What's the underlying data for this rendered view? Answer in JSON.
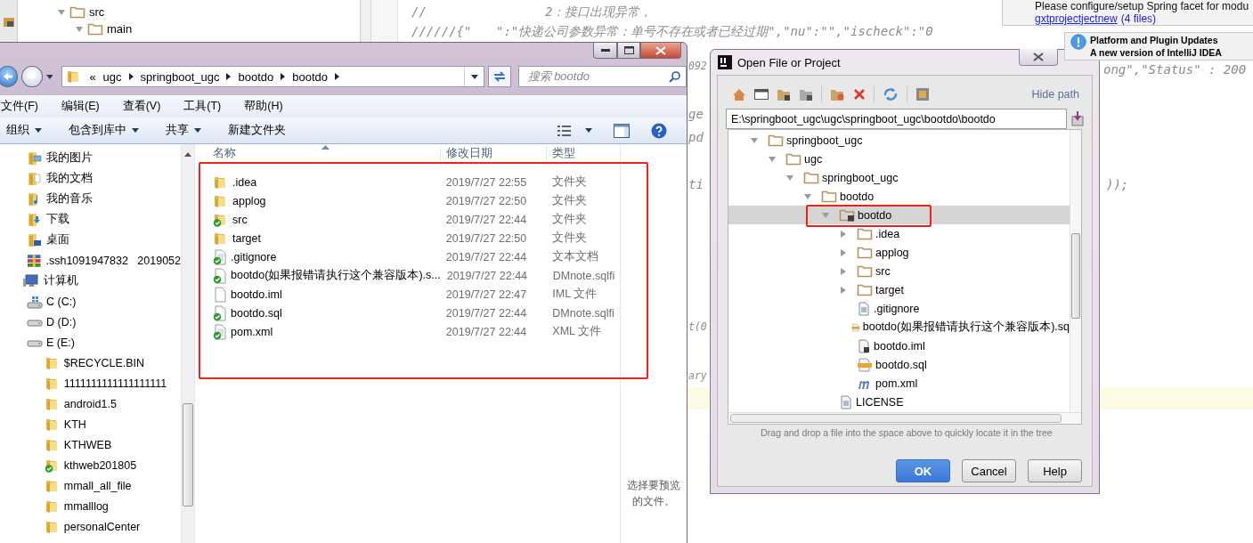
{
  "ide": {
    "project_tree": [
      {
        "label": "src",
        "expanded": true,
        "children": [
          {
            "label": "main",
            "expanded": true
          }
        ]
      }
    ],
    "code_fragments": [
      "//",
      "2：接口出现异常，",
      "//////{\"",
      "\":\"快递公司参数异常：单号不存在或者已经过期\",\"nu\":\"\",\"ischeck\":\"0",
      "092",
      "ong\",\"Status\" : 200",
      "ge",
      "pd",
      "ti",
      "));",
      "t(0",
      "ary"
    ],
    "notifications": [
      {
        "kind": "warning",
        "text": "Please configure/setup Spring facet for modu",
        "link": "gxtprojectjectnew",
        "files_link": "(4 files)"
      },
      {
        "kind": "info",
        "title": "Platform and Plugin Updates",
        "text": "A new version of IntelliJ IDEA"
      }
    ]
  },
  "explorer": {
    "address": {
      "overflow": "«",
      "crumbs": [
        "ugc",
        "springboot_ugc",
        "bootdo",
        "bootdo"
      ]
    },
    "search": {
      "placeholder": "搜索 bootdo"
    },
    "menu": [
      "文件(F)",
      "编辑(E)",
      "查看(V)",
      "工具(T)",
      "帮助(H)"
    ],
    "toolbar": [
      {
        "label": "组织",
        "dropdown": true
      },
      {
        "label": "包含到库中",
        "dropdown": true
      },
      {
        "label": "共享",
        "dropdown": true
      },
      {
        "label": "新建文件夹",
        "dropdown": false
      }
    ],
    "nav": [
      {
        "label": "我的图片",
        "kind": "pictures"
      },
      {
        "label": "我的文档",
        "kind": "documents"
      },
      {
        "label": "我的音乐",
        "kind": "music"
      },
      {
        "label": "下载",
        "kind": "downloads"
      },
      {
        "label": "桌面",
        "kind": "desktop"
      },
      {
        "label": ".ssh1091947832   2019052",
        "kind": "archive"
      },
      {
        "label": "计算机",
        "kind": "computer",
        "children": [
          {
            "label": "C (C:)",
            "kind": "system-drive"
          },
          {
            "label": "D (D:)",
            "kind": "drive"
          },
          {
            "label": "E (E:)",
            "kind": "drive",
            "children": [
              {
                "label": "$RECYCLE.BIN",
                "kind": "folder"
              },
              {
                "label": "1111111111111111111",
                "kind": "folder"
              },
              {
                "label": "android1.5",
                "kind": "folder"
              },
              {
                "label": "KTH",
                "kind": "folder"
              },
              {
                "label": "KTHWEB",
                "kind": "folder"
              },
              {
                "label": "kthweb201805",
                "kind": "synced-folder"
              },
              {
                "label": "mmall_all_file",
                "kind": "folder"
              },
              {
                "label": "mmalllog",
                "kind": "folder"
              },
              {
                "label": "personalCenter",
                "kind": "folder"
              }
            ]
          }
        ]
      }
    ],
    "columns": [
      "名称",
      "修改日期",
      "类型"
    ],
    "files": [
      {
        "name": ".idea",
        "date": "2019/7/27 22:55",
        "type": "文件夹",
        "kind": "folder",
        "synced": false
      },
      {
        "name": "applog",
        "date": "2019/7/27 22:50",
        "type": "文件夹",
        "kind": "folder",
        "synced": false
      },
      {
        "name": "src",
        "date": "2019/7/27 22:44",
        "type": "文件夹",
        "kind": "folder",
        "synced": true
      },
      {
        "name": "target",
        "date": "2019/7/27 22:50",
        "type": "文件夹",
        "kind": "folder",
        "synced": false
      },
      {
        "name": ".gitignore",
        "date": "2019/7/27 22:44",
        "type": "文本文档",
        "kind": "document",
        "synced": true
      },
      {
        "name": "bootdo(如果报错请执行这个兼容版本).s...",
        "date": "2019/7/27 22:44",
        "type": "DMnote.sqlfi",
        "kind": "blank",
        "synced": true
      },
      {
        "name": "bootdo.iml",
        "date": "2019/7/27 22:47",
        "type": "IML 文件",
        "kind": "blank",
        "synced": false
      },
      {
        "name": "bootdo.sql",
        "date": "2019/7/27 22:44",
        "type": "DMnote.sqlfi",
        "kind": "blank",
        "synced": true
      },
      {
        "name": "pom.xml",
        "date": "2019/7/27 22:44",
        "type": "XML 文件",
        "kind": "document",
        "synced": true
      }
    ],
    "preview": "选择要预览的文件。"
  },
  "dialog": {
    "title": "Open File or Project",
    "hide_path": "Hide path",
    "path": "E:\\springboot_ugc\\ugc\\springboot_ugc\\bootdo\\bootdo",
    "tree": [
      {
        "label": "springboot_ugc",
        "kind": "folder",
        "expanded": true,
        "selected": false,
        "children": [
          {
            "label": "ugc",
            "kind": "folder",
            "expanded": true,
            "selected": false,
            "children": [
              {
                "label": "springboot_ugc",
                "kind": "folder",
                "expanded": true,
                "selected": false,
                "children": [
                  {
                    "label": "bootdo",
                    "kind": "folder",
                    "expanded": true,
                    "selected": false,
                    "children": [
                      {
                        "label": "bootdo",
                        "kind": "module",
                        "expanded": true,
                        "selected": true,
                        "children": [
                          {
                            "label": ".idea",
                            "kind": "folder",
                            "expanded": false,
                            "selected": false
                          },
                          {
                            "label": "applog",
                            "kind": "folder",
                            "expanded": false,
                            "selected": false
                          },
                          {
                            "label": "src",
                            "kind": "folder",
                            "expanded": false,
                            "selected": false
                          },
                          {
                            "label": "target",
                            "kind": "folder",
                            "expanded": false,
                            "selected": false
                          },
                          {
                            "label": ".gitignore",
                            "kind": "text",
                            "selected": false
                          },
                          {
                            "label": "bootdo(如果报错请执行这个兼容版本).sq",
                            "kind": "sql",
                            "selected": false
                          },
                          {
                            "label": "bootdo.iml",
                            "kind": "iml",
                            "selected": false
                          },
                          {
                            "label": "bootdo.sql",
                            "kind": "sql",
                            "selected": false
                          },
                          {
                            "label": "pom.xml",
                            "kind": "maven",
                            "selected": false
                          }
                        ]
                      },
                      {
                        "label": "LICENSE",
                        "kind": "text",
                        "selected": false
                      }
                    ]
                  }
                ]
              }
            ]
          }
        ]
      }
    ],
    "hint": "Drag and drop a file into the space above to quickly locate it in the tree",
    "buttons": [
      {
        "label": "OK",
        "default": true
      },
      {
        "label": "Cancel",
        "default": false
      },
      {
        "label": "Help",
        "default": false
      }
    ]
  }
}
